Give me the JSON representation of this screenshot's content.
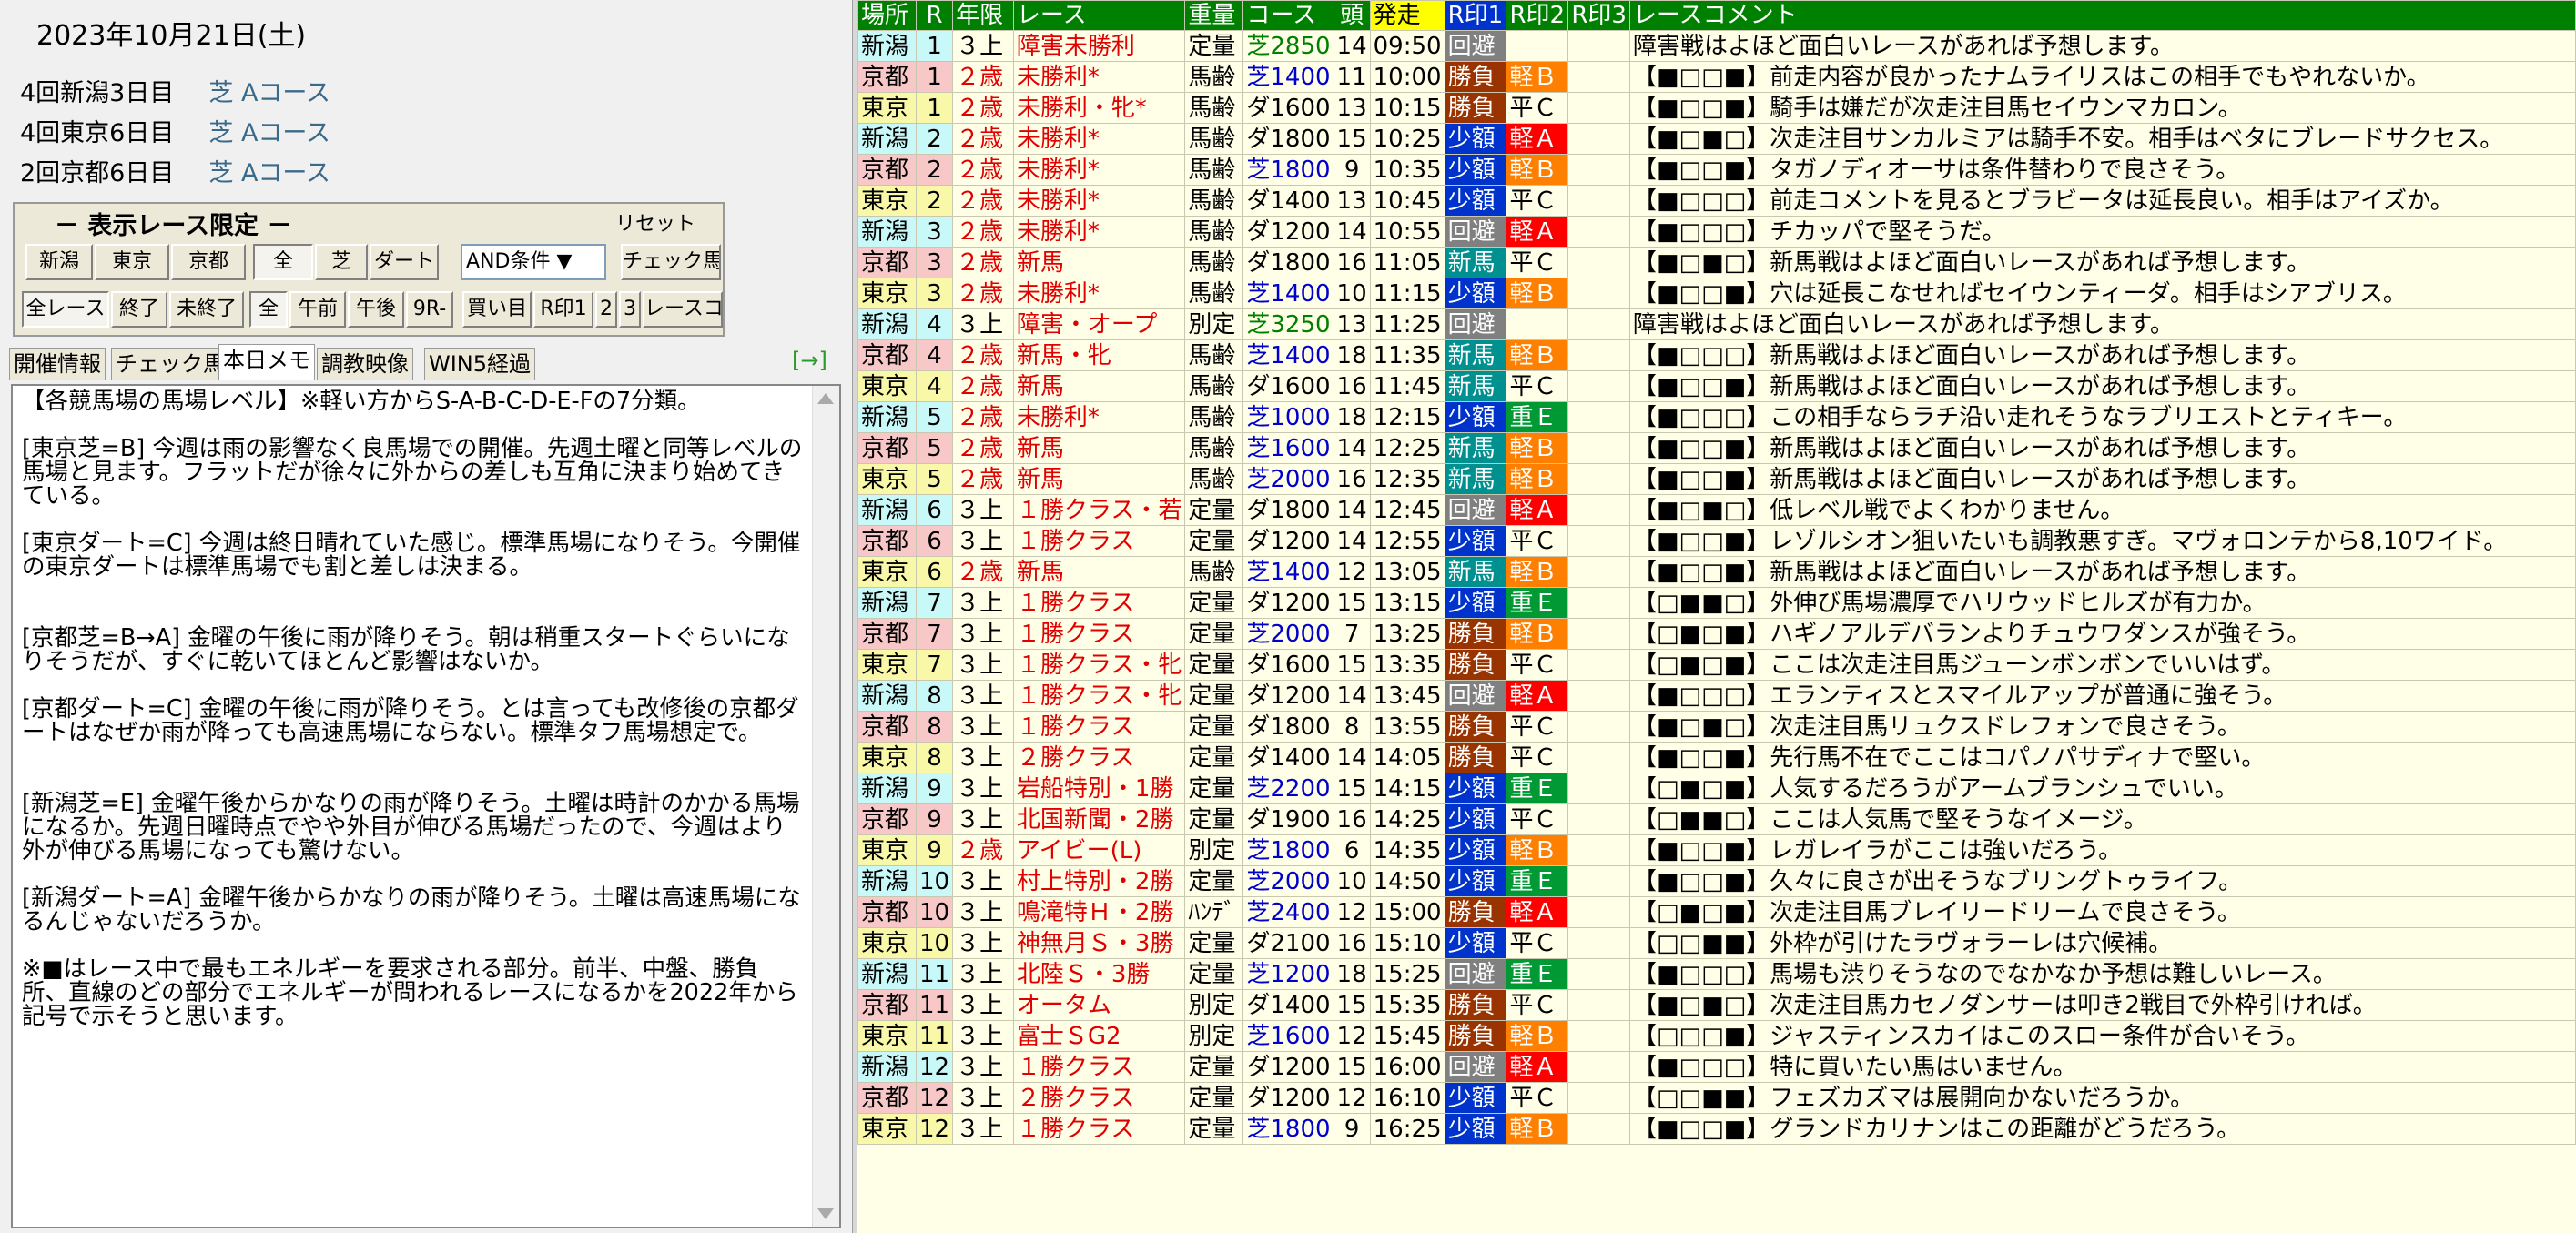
{
  "date": "2023年10月21日(土)",
  "venues": [
    {
      "name": "4回新潟3日目",
      "course": "芝 Aコース"
    },
    {
      "name": "4回東京6日目",
      "course": "芝 Aコース"
    },
    {
      "name": "2回京都6日目",
      "course": "芝 Aコース"
    }
  ],
  "filter": {
    "title": "－ 表示レース限定 －",
    "reset": "リセット",
    "row1": [
      "新潟",
      "東京",
      "京都",
      "全",
      "芝",
      "ダート"
    ],
    "condition": "AND条件 ▼",
    "check_button": "チェック馬",
    "row2": [
      "全レース",
      "終了",
      "未終了",
      "全",
      "午前",
      "午後",
      "9R-",
      "買い目",
      "R印1",
      "2",
      "3",
      "レースコメ"
    ]
  },
  "tabs": [
    "開催情報",
    "チェック馬",
    "本日メモ",
    "調教映像",
    "WIN5経過"
  ],
  "tab_arrow": "[→]",
  "memo": "【各競馬場の馬場レベル】※軽い方からS-A-B-C-D-E-Fの7分類。\n\n[東京芝=B] 今週は雨の影響なく良馬場での開催。先週土曜と同等レベルの馬場と見ます。フラットだが徐々に外からの差しも互角に決まり始めてきている。\n\n[東京ダート=C] 今週は終日晴れていた感じ。標準馬場になりそう。今開催の東京ダートは標準馬場でも割と差しは決まる。\n\n\n[京都芝=B→A] 金曜の午後に雨が降りそう。朝は稍重スタートぐらいになりそうだが、すぐに乾いてほとんど影響はないか。\n\n[京都ダート=C] 金曜の午後に雨が降りそう。とは言っても改修後の京都ダートはなぜか雨が降っても高速馬場にならない。標準タフ馬場想定で。\n\n\n[新潟芝=E] 金曜午後からかなりの雨が降りそう。土曜は時計のかかる馬場になるか。先週日曜時点でやや外目が伸びる馬場だったので、今週はより外が伸びる馬場になっても驚けない。\n\n[新潟ダート=A] 金曜午後からかなりの雨が降りそう。土曜は高速馬場になるんじゃないだろうか。\n\n※■はレース中で最もエネルギーを要求される部分。前半、中盤、勝負所、直線のどの部分でエネルギーが問われるレースになるかを2022年から記号で示そうと思います。",
  "columns": [
    "場所",
    "R",
    "年限",
    "レース",
    "重量",
    "コース",
    "頭",
    "発走",
    "R印1",
    "R印2",
    "R印3",
    "レースコメント"
  ],
  "rows": [
    {
      "place": "新潟",
      "r": "1",
      "age": "３上",
      "race": "障害未勝利",
      "weight": "定量",
      "course": "芝2850",
      "n": "14",
      "time": "09:50",
      "m1": "回避",
      "m2": "",
      "comment": "障害戦はよほど面白いレースがあれば予想します。"
    },
    {
      "place": "京都",
      "r": "1",
      "age": "２歳",
      "race": "未勝利*",
      "weight": "馬齢",
      "course": "芝1400",
      "n": "11",
      "time": "10:00",
      "m1": "勝負",
      "m2": "軽Ｂ",
      "comment": "【■□□■】前走内容が良かったナムライリスはこの相手でもやれないか。"
    },
    {
      "place": "東京",
      "r": "1",
      "age": "２歳",
      "race": "未勝利・牝*",
      "weight": "馬齢",
      "course": "ダ1600",
      "n": "13",
      "time": "10:15",
      "m1": "勝負",
      "m2": "平Ｃ",
      "comment": "【■□□■】騎手は嫌だが次走注目馬セイウンマカロン。"
    },
    {
      "place": "新潟",
      "r": "2",
      "age": "２歳",
      "race": "未勝利*",
      "weight": "馬齢",
      "course": "ダ1800",
      "n": "15",
      "time": "10:25",
      "m1": "少額",
      "m2": "軽Ａ",
      "comment": "【■□■□】次走注目サンカルミアは騎手不安。相手はベタにブレードサクセス。"
    },
    {
      "place": "京都",
      "r": "2",
      "age": "２歳",
      "race": "未勝利*",
      "weight": "馬齢",
      "course": "芝1800",
      "n": "9",
      "time": "10:35",
      "m1": "少額",
      "m2": "軽Ｂ",
      "comment": "【■□□■】タガノディオーサは条件替わりで良さそう。"
    },
    {
      "place": "東京",
      "r": "2",
      "age": "２歳",
      "race": "未勝利*",
      "weight": "馬齢",
      "course": "ダ1400",
      "n": "13",
      "time": "10:45",
      "m1": "少額",
      "m2": "平Ｃ",
      "comment": "【■□□□】前走コメントを見るとブラビータは延長良い。相手はアイズか。"
    },
    {
      "place": "新潟",
      "r": "3",
      "age": "２歳",
      "race": "未勝利*",
      "weight": "馬齢",
      "course": "ダ1200",
      "n": "14",
      "time": "10:55",
      "m1": "回避",
      "m2": "軽Ａ",
      "comment": "【■□□□】チカッパで堅そうだ。"
    },
    {
      "place": "京都",
      "r": "3",
      "age": "２歳",
      "race": "新馬",
      "weight": "馬齢",
      "course": "ダ1800",
      "n": "16",
      "time": "11:05",
      "m1": "新馬",
      "m2": "平Ｃ",
      "comment": "【■□■□】新馬戦はよほど面白いレースがあれば予想します。"
    },
    {
      "place": "東京",
      "r": "3",
      "age": "２歳",
      "race": "未勝利*",
      "weight": "馬齢",
      "course": "芝1400",
      "n": "10",
      "time": "11:15",
      "m1": "少額",
      "m2": "軽Ｂ",
      "comment": "【■□□■】穴は延長こなせればセイウンティーダ。相手はシアブリス。"
    },
    {
      "place": "新潟",
      "r": "4",
      "age": "３上",
      "race": "障害・オープ",
      "weight": "別定",
      "course": "芝3250",
      "n": "13",
      "time": "11:25",
      "m1": "回避",
      "m2": "",
      "comment": "障害戦はよほど面白いレースがあれば予想します。"
    },
    {
      "place": "京都",
      "r": "4",
      "age": "２歳",
      "race": "新馬・牝",
      "weight": "馬齢",
      "course": "芝1400",
      "n": "18",
      "time": "11:35",
      "m1": "新馬",
      "m2": "軽Ｂ",
      "comment": "【■□□□】新馬戦はよほど面白いレースがあれば予想します。"
    },
    {
      "place": "東京",
      "r": "4",
      "age": "２歳",
      "race": "新馬",
      "weight": "馬齢",
      "course": "ダ1600",
      "n": "16",
      "time": "11:45",
      "m1": "新馬",
      "m2": "平Ｃ",
      "comment": "【■□□■】新馬戦はよほど面白いレースがあれば予想します。"
    },
    {
      "place": "新潟",
      "r": "5",
      "age": "２歳",
      "race": "未勝利*",
      "weight": "馬齢",
      "course": "芝1000",
      "n": "18",
      "time": "12:15",
      "m1": "少額",
      "m2": "重Ｅ",
      "comment": "【■□□□】この相手ならラチ沿い走れそうなラブリエストとティキー。"
    },
    {
      "place": "京都",
      "r": "5",
      "age": "２歳",
      "race": "新馬",
      "weight": "馬齢",
      "course": "芝1600",
      "n": "14",
      "time": "12:25",
      "m1": "新馬",
      "m2": "軽Ｂ",
      "comment": "【■□□■】新馬戦はよほど面白いレースがあれば予想します。"
    },
    {
      "place": "東京",
      "r": "5",
      "age": "２歳",
      "race": "新馬",
      "weight": "馬齢",
      "course": "芝2000",
      "n": "16",
      "time": "12:35",
      "m1": "新馬",
      "m2": "軽Ｂ",
      "comment": "【■□□■】新馬戦はよほど面白いレースがあれば予想します。"
    },
    {
      "place": "新潟",
      "r": "6",
      "age": "３上",
      "race": "１勝クラス・若",
      "weight": "定量",
      "course": "ダ1800",
      "n": "14",
      "time": "12:45",
      "m1": "回避",
      "m2": "軽Ａ",
      "comment": "【■□■□】低レベル戦でよくわかりません。"
    },
    {
      "place": "京都",
      "r": "6",
      "age": "３上",
      "race": "１勝クラス",
      "weight": "定量",
      "course": "ダ1200",
      "n": "14",
      "time": "12:55",
      "m1": "少額",
      "m2": "平Ｃ",
      "comment": "【■□□■】レゾルシオン狙いたいも調教悪すぎ。マヴォロンテから8,10ワイド。"
    },
    {
      "place": "東京",
      "r": "6",
      "age": "２歳",
      "race": "新馬",
      "weight": "馬齢",
      "course": "芝1400",
      "n": "12",
      "time": "13:05",
      "m1": "新馬",
      "m2": "軽Ｂ",
      "comment": "【■□□■】新馬戦はよほど面白いレースがあれば予想します。"
    },
    {
      "place": "新潟",
      "r": "7",
      "age": "３上",
      "race": "１勝クラス",
      "weight": "定量",
      "course": "ダ1200",
      "n": "15",
      "time": "13:15",
      "m1": "少額",
      "m2": "重Ｅ",
      "comment": "【□■■□】外伸び馬場濃厚でハリウッドヒルズが有力か。"
    },
    {
      "place": "京都",
      "r": "7",
      "age": "３上",
      "race": "１勝クラス",
      "weight": "定量",
      "course": "芝2000",
      "n": "7",
      "time": "13:25",
      "m1": "勝負",
      "m2": "軽Ｂ",
      "comment": "【□■□■】ハギノアルデバランよりチュウワダンスが強そう。"
    },
    {
      "place": "東京",
      "r": "7",
      "age": "３上",
      "race": "１勝クラス・牝",
      "weight": "定量",
      "course": "ダ1600",
      "n": "15",
      "time": "13:35",
      "m1": "勝負",
      "m2": "平Ｃ",
      "comment": "【□■□■】ここは次走注目馬ジューンボンボンでいいはず。"
    },
    {
      "place": "新潟",
      "r": "8",
      "age": "３上",
      "race": "１勝クラス・牝",
      "weight": "定量",
      "course": "ダ1200",
      "n": "14",
      "time": "13:45",
      "m1": "回避",
      "m2": "軽Ａ",
      "comment": "【■□□□】エランティスとスマイルアップが普通に強そう。"
    },
    {
      "place": "京都",
      "r": "8",
      "age": "３上",
      "race": "１勝クラス",
      "weight": "定量",
      "course": "ダ1800",
      "n": "8",
      "time": "13:55",
      "m1": "勝負",
      "m2": "平Ｃ",
      "comment": "【■□■□】次走注目馬リュクスドレフォンで良さそう。"
    },
    {
      "place": "東京",
      "r": "8",
      "age": "３上",
      "race": "２勝クラス",
      "weight": "定量",
      "course": "ダ1400",
      "n": "14",
      "time": "14:05",
      "m1": "勝負",
      "m2": "平Ｃ",
      "comment": "【■□□■】先行馬不在でここはコパノパサディナで堅い。"
    },
    {
      "place": "新潟",
      "r": "9",
      "age": "３上",
      "race": "岩船特別・1勝",
      "weight": "定量",
      "course": "芝2200",
      "n": "15",
      "time": "14:15",
      "m1": "少額",
      "m2": "重Ｅ",
      "comment": "【□■□■】人気するだろうがアームブランシュでいい。"
    },
    {
      "place": "京都",
      "r": "9",
      "age": "３上",
      "race": "北国新聞・2勝",
      "weight": "定量",
      "course": "ダ1900",
      "n": "16",
      "time": "14:25",
      "m1": "少額",
      "m2": "平Ｃ",
      "comment": "【□■■□】ここは人気馬で堅そうなイメージ。"
    },
    {
      "place": "東京",
      "r": "9",
      "age": "２歳",
      "race": "アイビー(L)",
      "weight": "別定",
      "course": "芝1800",
      "n": "6",
      "time": "14:35",
      "m1": "少額",
      "m2": "軽Ｂ",
      "comment": "【■□□■】レガレイラがここは強いだろう。"
    },
    {
      "place": "新潟",
      "r": "10",
      "age": "３上",
      "race": "村上特別・2勝",
      "weight": "定量",
      "course": "芝2000",
      "n": "10",
      "time": "14:50",
      "m1": "少額",
      "m2": "重Ｅ",
      "comment": "【■□□■】久々に良さが出そうなブリングトゥライフ。"
    },
    {
      "place": "京都",
      "r": "10",
      "age": "３上",
      "race": "鳴滝特Ｈ・2勝",
      "weight": "ﾊﾝﾃﾞ",
      "course": "芝2400",
      "n": "12",
      "time": "15:00",
      "m1": "勝負",
      "m2": "軽Ａ",
      "comment": "【□■□■】次走注目馬ブレイリードリームで良さそう。"
    },
    {
      "place": "東京",
      "r": "10",
      "age": "３上",
      "race": "神無月Ｓ・3勝",
      "weight": "定量",
      "course": "ダ2100",
      "n": "16",
      "time": "15:10",
      "m1": "少額",
      "m2": "平Ｃ",
      "comment": "【□□■■】外枠が引けたラヴォラーレは穴候補。"
    },
    {
      "place": "新潟",
      "r": "11",
      "age": "３上",
      "race": "北陸Ｓ・3勝",
      "weight": "定量",
      "course": "芝1200",
      "n": "18",
      "time": "15:25",
      "m1": "回避",
      "m2": "重Ｅ",
      "comment": "【■□□□】馬場も渋りそうなのでなかなか予想は難しいレース。"
    },
    {
      "place": "京都",
      "r": "11",
      "age": "３上",
      "race": "オータム",
      "weight": "別定",
      "course": "ダ1400",
      "n": "15",
      "time": "15:35",
      "m1": "勝負",
      "m2": "平Ｃ",
      "comment": "【■□■□】次走注目馬カセノダンサーは叩き2戦目で外枠引ければ。"
    },
    {
      "place": "東京",
      "r": "11",
      "age": "３上",
      "race": "富士ＳG2",
      "weight": "別定",
      "course": "芝1600",
      "n": "12",
      "time": "15:45",
      "m1": "勝負",
      "m2": "軽Ｂ",
      "comment": "【□□□■】ジャスティンスカイはこのスロー条件が合いそう。"
    },
    {
      "place": "新潟",
      "r": "12",
      "age": "３上",
      "race": "１勝クラス",
      "weight": "定量",
      "course": "ダ1200",
      "n": "15",
      "time": "16:00",
      "m1": "回避",
      "m2": "軽Ａ",
      "comment": "【■□□□】特に買いたい馬はいません。"
    },
    {
      "place": "京都",
      "r": "12",
      "age": "３上",
      "race": "２勝クラス",
      "weight": "定量",
      "course": "ダ1200",
      "n": "12",
      "time": "16:10",
      "m1": "少額",
      "m2": "平Ｃ",
      "comment": "【□□■■】フェズカズマは展開向かないだろうか。"
    },
    {
      "place": "東京",
      "r": "12",
      "age": "３上",
      "race": "１勝クラス",
      "weight": "定量",
      "course": "芝1800",
      "n": "9",
      "time": "16:25",
      "m1": "少額",
      "m2": "軽Ｂ",
      "comment": "【■□□■】グランドカリナンはこの距離がどうだろう。"
    }
  ]
}
